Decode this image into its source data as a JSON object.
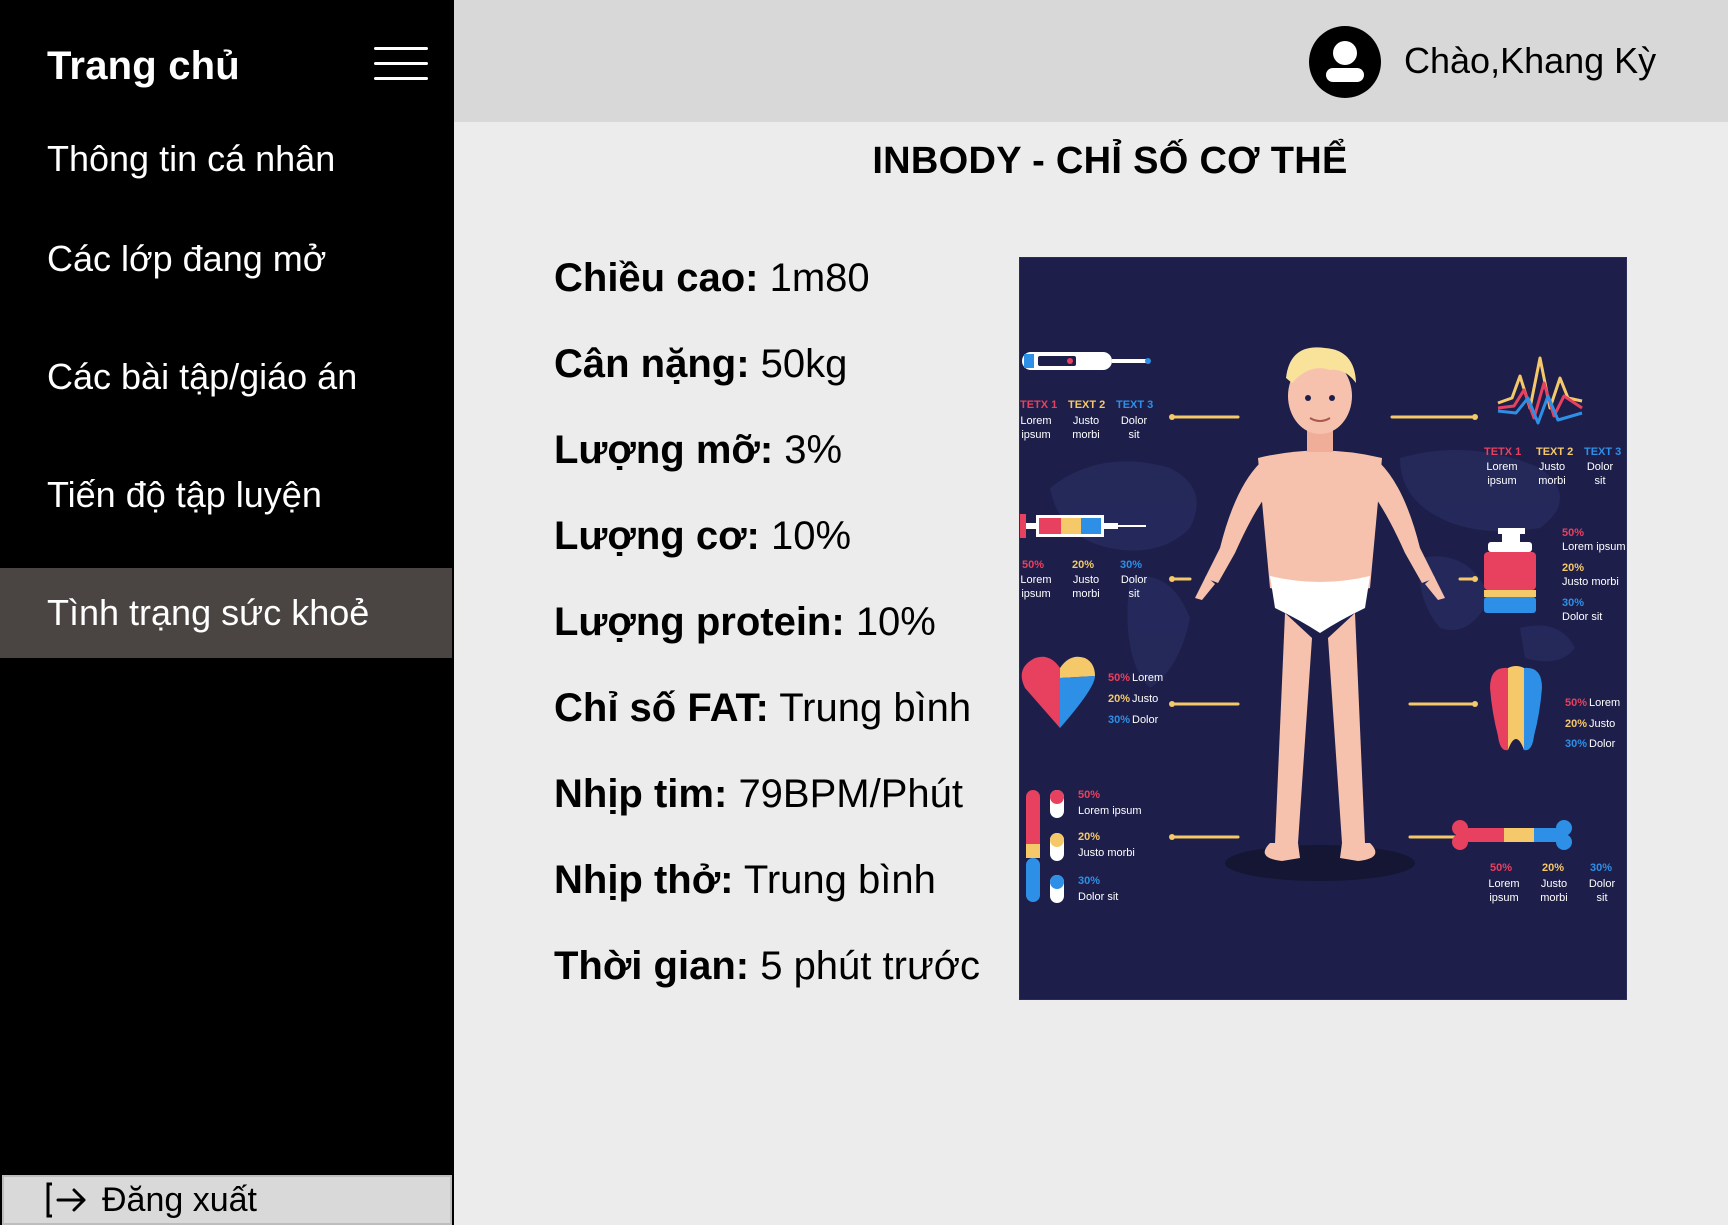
{
  "sidebar": {
    "brand": "Trang chủ",
    "items": [
      {
        "label": "Thông tin cá nhân"
      },
      {
        "label": "Các lớp đang mở"
      },
      {
        "label": "Các bài tập/giáo án"
      },
      {
        "label": "Tiến độ tập luyện"
      },
      {
        "label": "Tình trạng sức khoẻ",
        "active": true
      }
    ],
    "logout_label": "Đăng xuất"
  },
  "header": {
    "greeting": "Chào,Khang Kỳ"
  },
  "main": {
    "title": "INBODY - CHỈ SỐ CƠ THỂ",
    "stats": [
      {
        "label": "Chiều cao:",
        "value": "1m80"
      },
      {
        "label": "Cân nặng:",
        "value": "50kg"
      },
      {
        "label": "Lượng mỡ:",
        "value": "3%"
      },
      {
        "label": "Lượng cơ:",
        "value": "10%"
      },
      {
        "label": "Lượng protein:",
        "value": "10%"
      },
      {
        "label": "Chỉ số FAT:",
        "value": "Trung bình"
      },
      {
        "label": "Nhịp tim:",
        "value": "79BPM/Phút"
      },
      {
        "label": "Nhịp thở:",
        "value": "Trung bình"
      },
      {
        "label": "Thời gian:",
        "value": "5 phút trước"
      }
    ]
  },
  "infographic": {
    "labels": {
      "tetx1": "TETX 1",
      "text2": "TEXT 2",
      "text3": "TEXT 3",
      "pct50": "50%",
      "pct20": "20%",
      "pct30": "30%",
      "lorem": "Lorem",
      "ipsum": "ipsum",
      "justo": "Justo",
      "morbi": "morbi",
      "dolor": "Dolor",
      "sit": "sit",
      "lorem_ipsum": "Lorem ipsum",
      "justo_morbi": "Justo morbi",
      "dolor_sit": "Dolor sit"
    },
    "colors": {
      "background": "#1d1f4a",
      "red": "#e8405f",
      "yellow": "#f5c96a",
      "blue": "#2e8fe6",
      "skin": "#f7c2ad",
      "hair": "#f9e29a"
    }
  }
}
